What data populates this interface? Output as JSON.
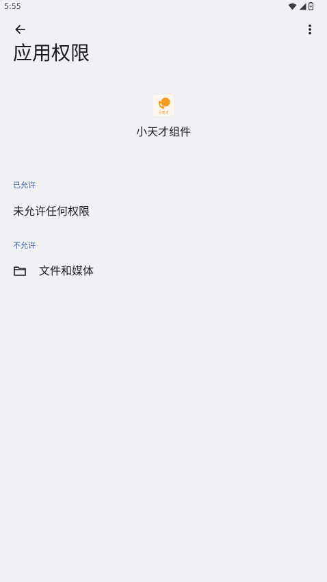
{
  "status_bar": {
    "time": "5:55",
    "icons": [
      "wifi-icon",
      "signal-icon",
      "battery-icon"
    ]
  },
  "toolbar": {
    "back_icon": "arrow-back-icon",
    "more_icon": "more-vert-icon"
  },
  "page": {
    "title": "应用权限"
  },
  "app": {
    "icon": "app-icon",
    "name": "小天才组件",
    "icon_label": "小天才"
  },
  "sections": {
    "allowed": {
      "header": "已允许",
      "empty_text": "未允许任何权限"
    },
    "not_allowed": {
      "header": "不允许",
      "items": [
        {
          "icon": "folder-icon",
          "label": "文件和媒体"
        }
      ]
    }
  },
  "colors": {
    "background": "#f1f0f5",
    "section_header": "#3a5f9a",
    "text_primary": "#1b1b1f",
    "app_icon_accent": "#f39c1f"
  }
}
